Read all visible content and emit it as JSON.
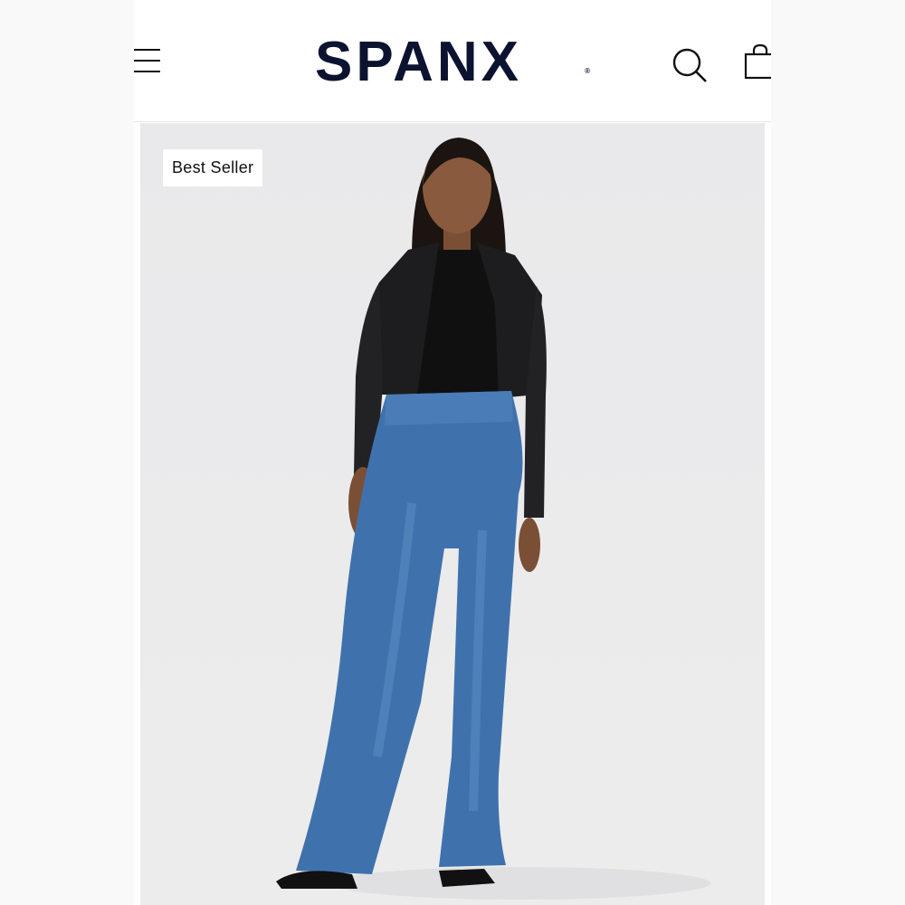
{
  "header": {
    "logo_text": "SPANX",
    "logo_mark": "®",
    "icons": [
      "menu-icon",
      "search-icon",
      "shopping-bag-icon"
    ]
  },
  "product": {
    "badge": "Best Seller"
  },
  "colors": {
    "brand": "#0c1330",
    "hero_background": "#ebebec",
    "denim": "#3f72ad"
  }
}
